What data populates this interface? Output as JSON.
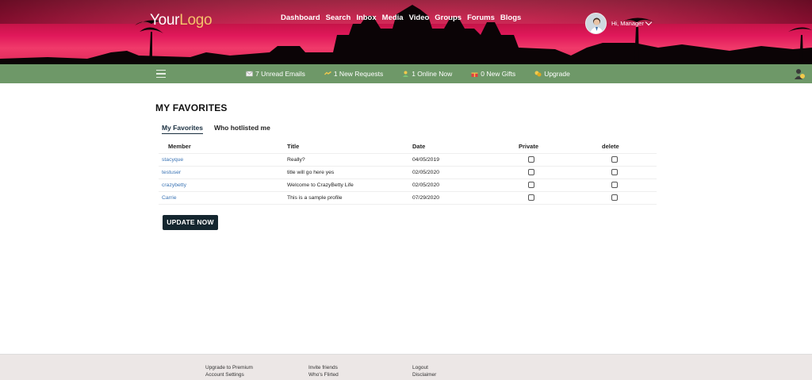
{
  "brand": {
    "logo_part1": "Your",
    "logo_part2": "Logo"
  },
  "main_nav": [
    "Dashboard",
    "Search",
    "Inbox",
    "Media",
    "Video",
    "Groups",
    "Forums",
    "Blogs"
  ],
  "user": {
    "greeting": "Hi, Manager"
  },
  "status_bar": {
    "unread_emails": "7 Unread Emails",
    "new_requests": "1 New Requests",
    "online_now": "1 Online Now",
    "new_gifts": "0 New Gifts",
    "upgrade": "Upgrade"
  },
  "page": {
    "title": "MY FAVORITES"
  },
  "tabs": [
    "My Favorites",
    "Who hotlisted me"
  ],
  "table": {
    "headers": {
      "member": "Member",
      "title": "Title",
      "date": "Date",
      "private": "Private",
      "delete": "delete"
    },
    "rows": [
      {
        "member": "stacyque",
        "title": "Really?",
        "date": "04/05/2019"
      },
      {
        "member": "testuser",
        "title": "title will go here yes",
        "date": "02/05/2020"
      },
      {
        "member": "crazybetty",
        "title": "Welcome to CrazyBetty Life",
        "date": "02/05/2020"
      },
      {
        "member": "Carrie",
        "title": "This is a sample profile",
        "date": "07/29/2020"
      }
    ]
  },
  "update_button": "UPDATE NOW",
  "footer": {
    "col1": [
      "Upgrade to Premium",
      "Account Settings"
    ],
    "col2": [
      "Invite friends",
      "Who's Flirted"
    ],
    "col3": [
      "Logout",
      "Disclaimer"
    ]
  },
  "colors": {
    "green_bar": "#6e9868",
    "button_dark": "#14262f",
    "link_blue": "#3a73b4",
    "footer_bg": "#ece7e6"
  }
}
